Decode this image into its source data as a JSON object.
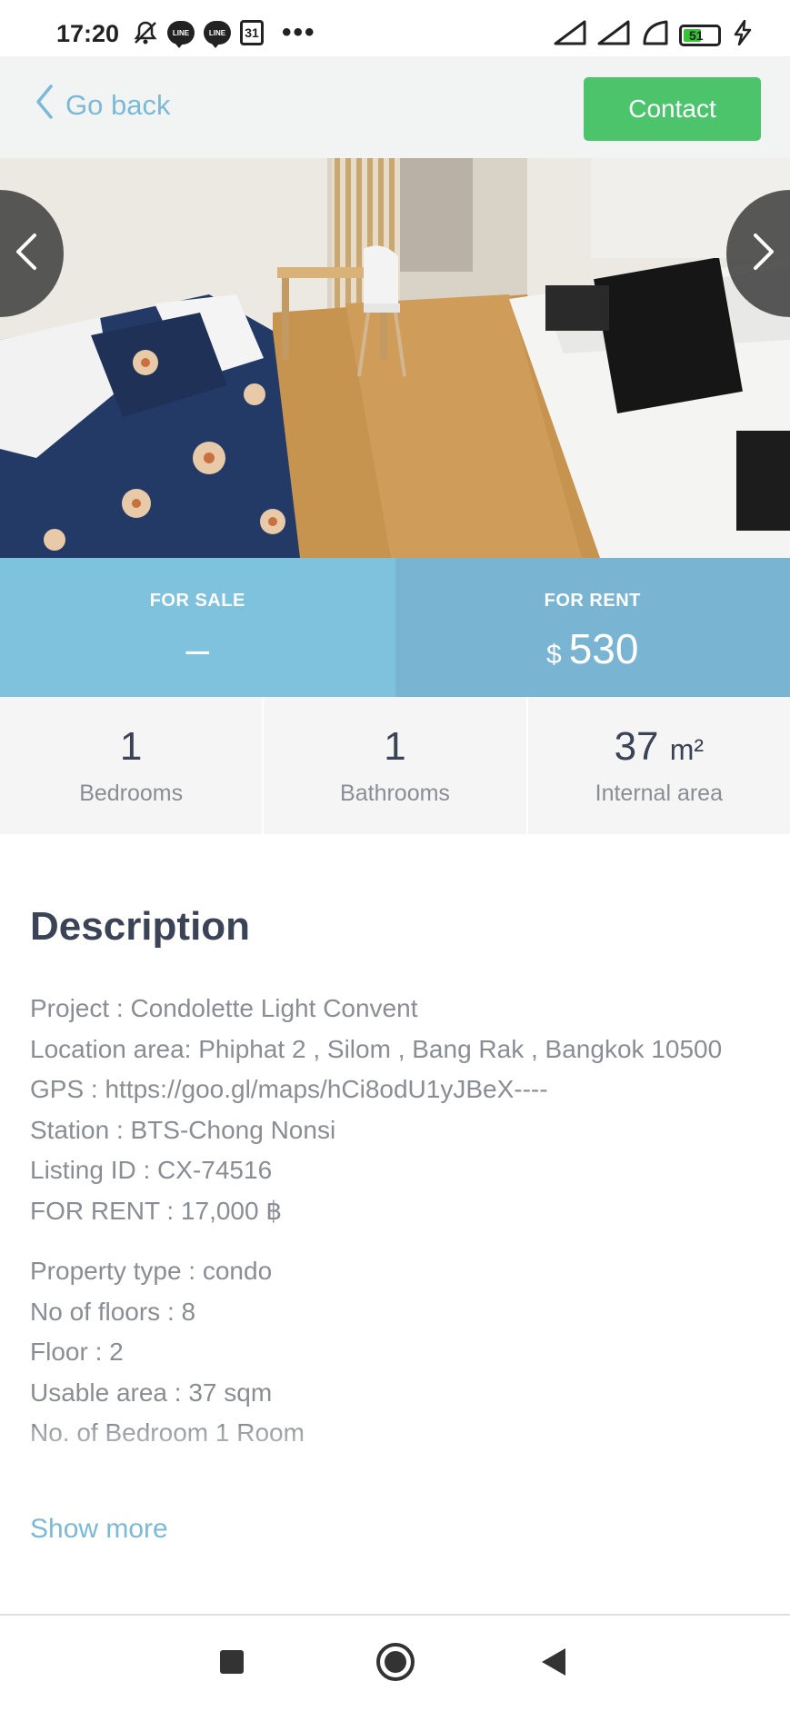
{
  "status_bar": {
    "time": "17:20",
    "calendar_day": "31",
    "line_label": "LINE",
    "battery_level": 51,
    "battery_percent_text": "51",
    "battery_fill_color": "#34c434",
    "left_icons": [
      "mute-bell-icon",
      "line-app-icon",
      "line-app-icon",
      "calendar-icon",
      "more-dots-icon"
    ],
    "right_icons": [
      "signal-icon",
      "signal-icon",
      "wifi-icon",
      "battery-icon",
      "charging-bolt-icon"
    ]
  },
  "topbar": {
    "back_label": "Go back",
    "contact_label": "Contact",
    "accent_color": "#7bbad6",
    "contact_color": "#4cc46c"
  },
  "gallery": {
    "prev_icon": "chevron-left-icon",
    "next_icon": "chevron-right-icon"
  },
  "price": {
    "sale_label": "FOR SALE",
    "sale_value": "–",
    "rent_label": "FOR RENT",
    "rent_currency": "$",
    "rent_value": "530"
  },
  "stats": [
    {
      "value": "1",
      "unit": "",
      "label": "Bedrooms"
    },
    {
      "value": "1",
      "unit": "",
      "label": "Bathrooms"
    },
    {
      "value": "37",
      "unit": "m²",
      "label": "Internal area"
    }
  ],
  "description": {
    "title": "Description",
    "lines_group1": [
      "Project : Condolette Light Convent",
      "Location area: Phiphat 2 , Silom , Bang Rak , Bangkok 10500",
      "GPS : https://goo.gl/maps/hCi8odU1yJBeX----",
      "Station : BTS-Chong Nonsi",
      "Listing ID : CX-74516",
      "FOR RENT : 17,000 ฿"
    ],
    "lines_group2": [
      "Property type : condo",
      "No of floors : 8",
      "Floor : 2",
      "Usable area : 37 sqm",
      "No. of Bedroom 1 Room"
    ],
    "show_more": "Show more"
  },
  "android_nav": {
    "recents_icon": "recents-square-icon",
    "home_icon": "home-circle-icon",
    "back_icon": "back-triangle-icon"
  }
}
